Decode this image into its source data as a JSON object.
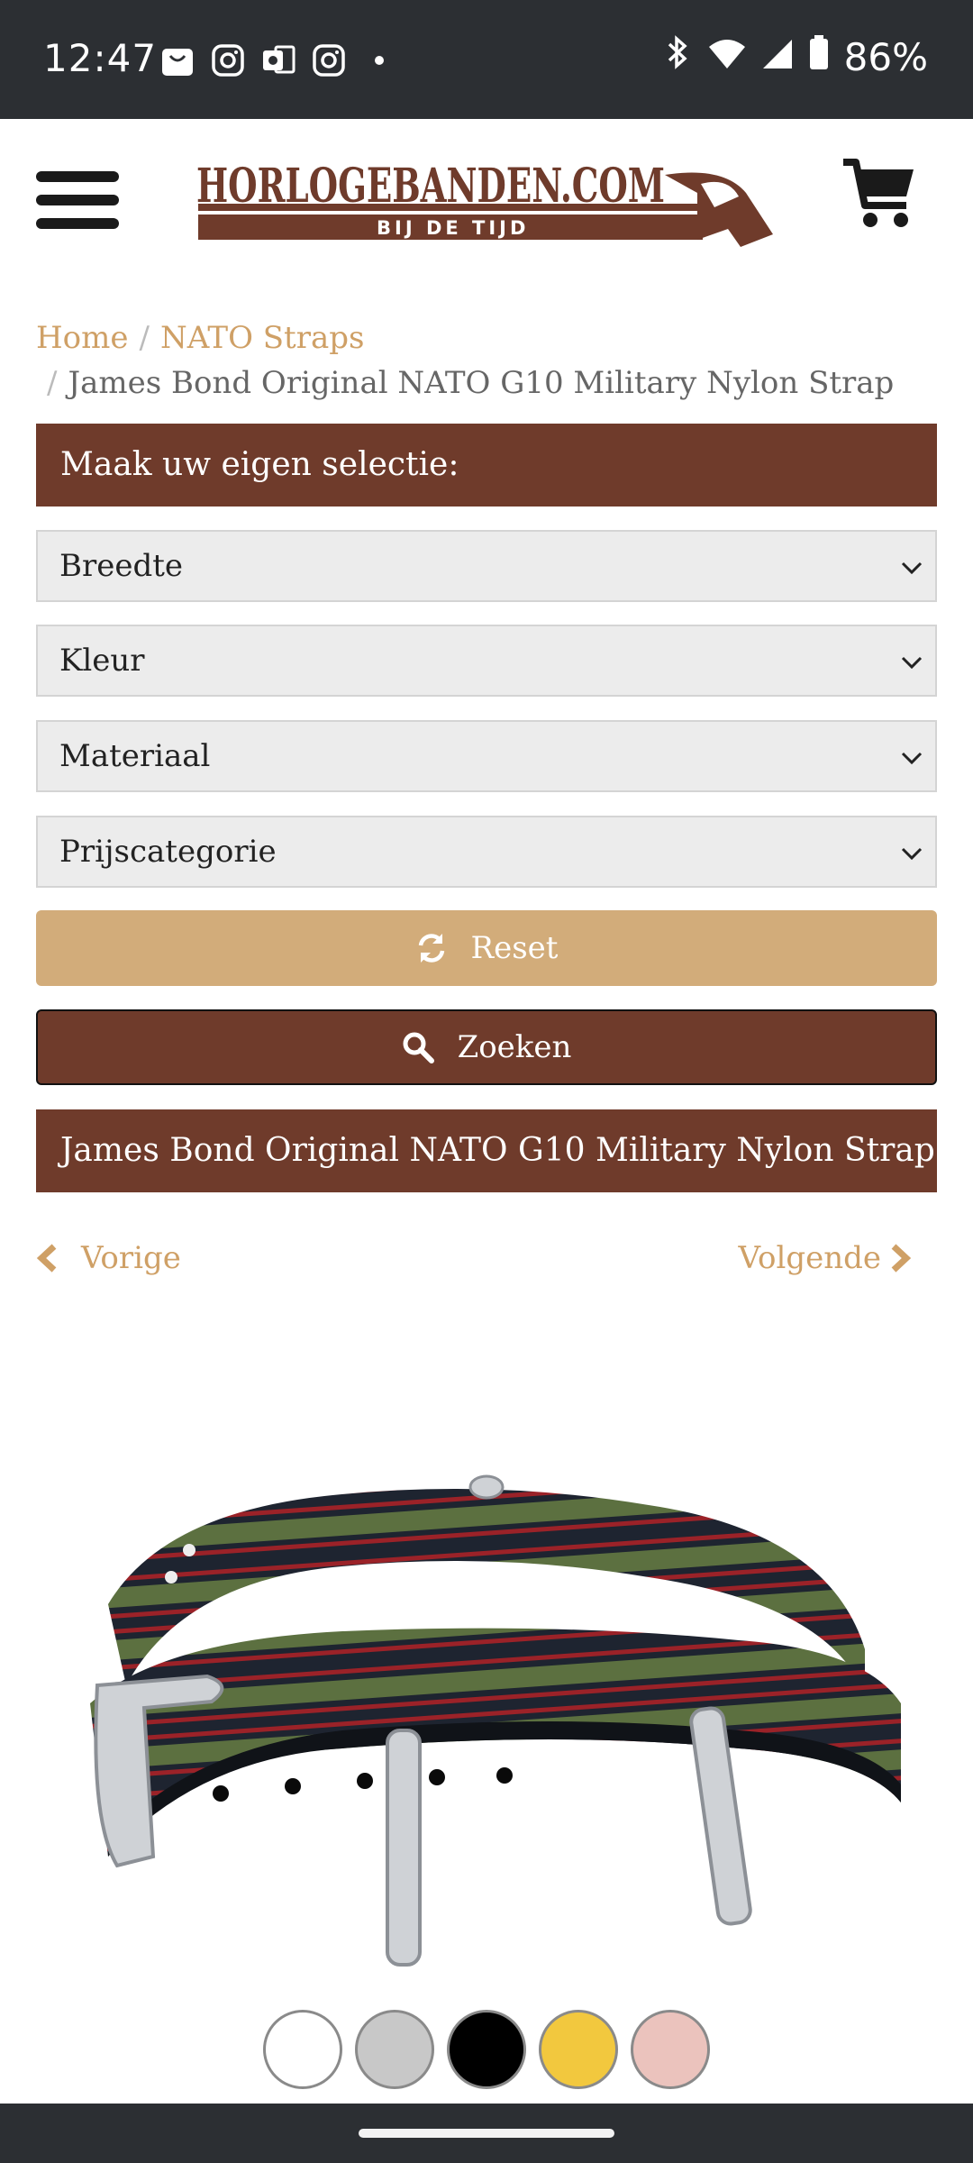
{
  "status_bar": {
    "time": "12:47",
    "battery": "86%",
    "notification_icons": [
      "shopping-bag-icon",
      "instagram-icon",
      "outlook-icon",
      "instagram-icon",
      "dot-icon"
    ]
  },
  "header": {
    "logo_text": "HORLOGEBANDEN.COM",
    "logo_tagline": "BIJ DE TIJD"
  },
  "breadcrumb": {
    "items": [
      "Home",
      "NATO Straps"
    ],
    "current": "James Bond Original NATO G10 Military Nylon Strap",
    "separator": "/"
  },
  "filter_panel": {
    "title": "Maak uw eigen selectie:",
    "selects": [
      "Breedte",
      "Kleur",
      "Materiaal",
      "Prijscategorie"
    ],
    "reset_label": "Reset",
    "search_label": "Zoeken"
  },
  "product": {
    "title": "James Bond Original NATO G10 Military Nylon Strap",
    "prev_label": "Vorige",
    "next_label": "Volgende"
  },
  "swatches": [
    "#ffffff",
    "#c8c8c8",
    "#000000",
    "#f2c83e",
    "#ebc3bd"
  ],
  "colors": {
    "brand_brown": "#6f3b2b",
    "gold": "#d2ac7a",
    "link": "#cfa066",
    "system_bar": "#2c2f33"
  }
}
